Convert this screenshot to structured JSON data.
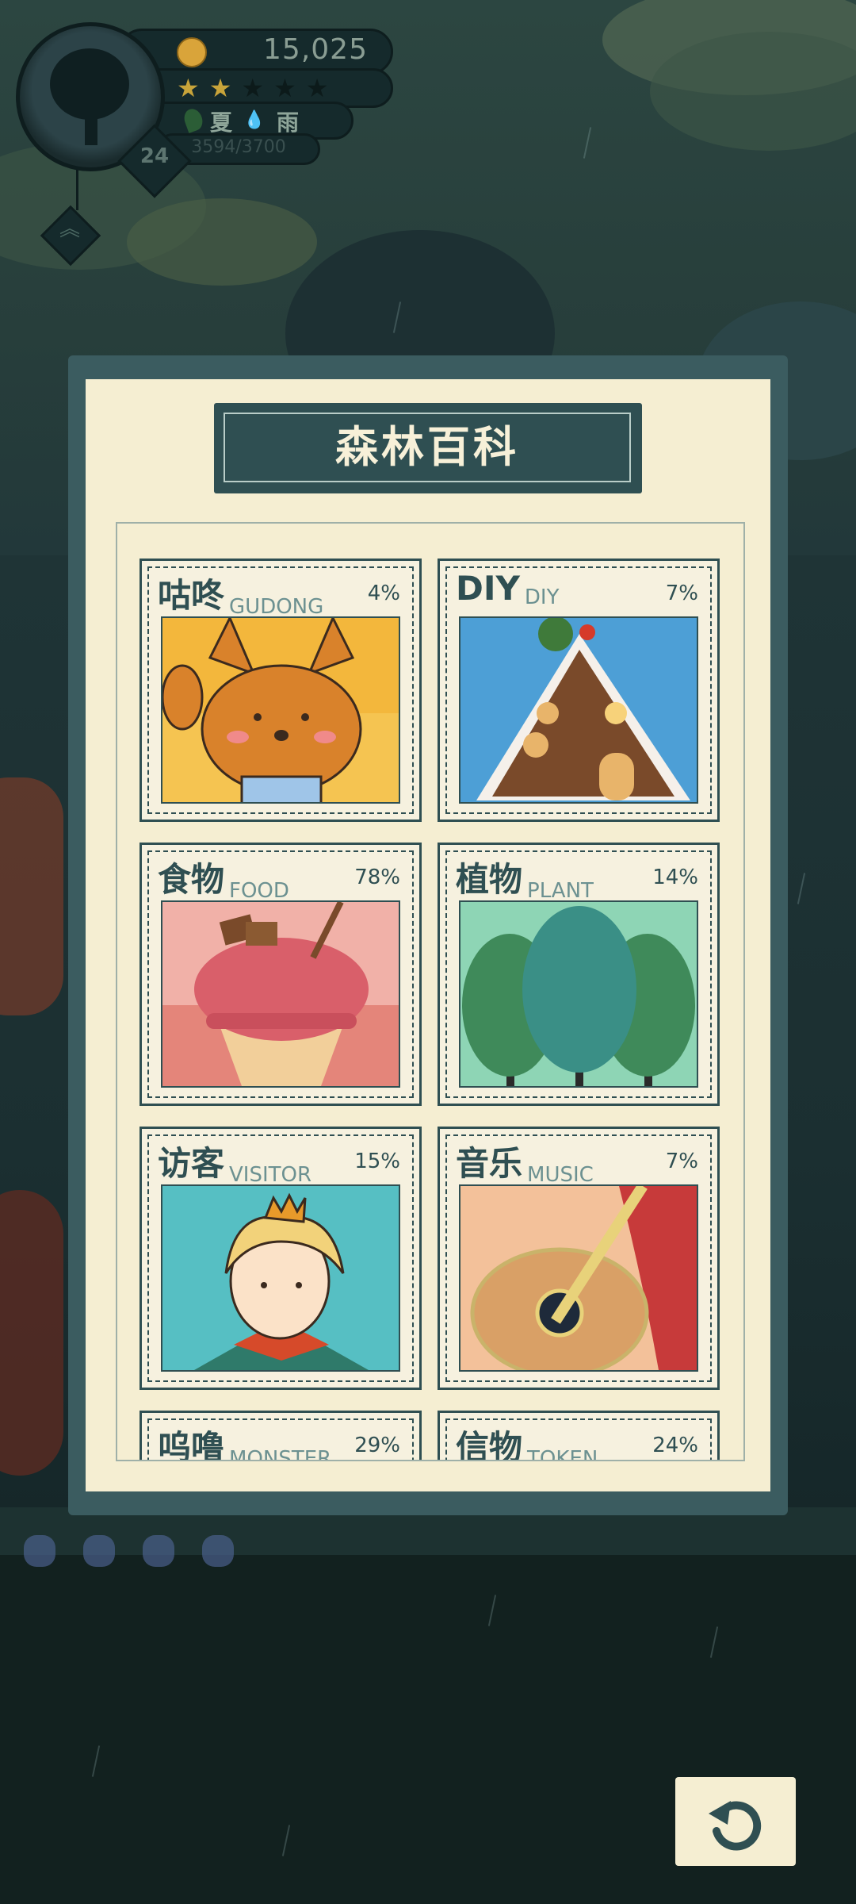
{
  "hud": {
    "coins": "15,025",
    "stars": {
      "filled": 2,
      "total": 5
    },
    "season": "夏",
    "weather": "雨",
    "xp": "3594/3700",
    "level": "24",
    "icons": [
      "coin-icon",
      "star-icon",
      "leaf-icon",
      "raindrop-icon",
      "tree-icon",
      "chevron-up-icon"
    ]
  },
  "panel": {
    "title": "森林百科",
    "categories": [
      {
        "name": "咕咚",
        "en": "GUDONG",
        "percent": "4%",
        "icon": "fox-illustration"
      },
      {
        "name": "DIY",
        "en": "DIY",
        "percent": "7%",
        "icon": "gingerbread-house-illustration"
      },
      {
        "name": "食物",
        "en": "FOOD",
        "percent": "78%",
        "icon": "ice-cream-illustration"
      },
      {
        "name": "植物",
        "en": "PLANT",
        "percent": "14%",
        "icon": "trees-illustration"
      },
      {
        "name": "访客",
        "en": "VISITOR",
        "percent": "15%",
        "icon": "prince-illustration"
      },
      {
        "name": "音乐",
        "en": "MUSIC",
        "percent": "7%",
        "icon": "guitar-illustration"
      },
      {
        "name": "呜噜",
        "en": "MONSTER",
        "percent": "29%",
        "icon": "monster-illustration"
      },
      {
        "name": "信物",
        "en": "TOKEN",
        "percent": "24%",
        "icon": "token-illustration"
      }
    ]
  },
  "back_button": {
    "icon": "back-arrow-icon"
  },
  "colors": {
    "panel_border": "#3b5c60",
    "panel_bg": "#f5eed2",
    "title_bg": "#2f4f52",
    "accent_text": "#6c9191"
  }
}
